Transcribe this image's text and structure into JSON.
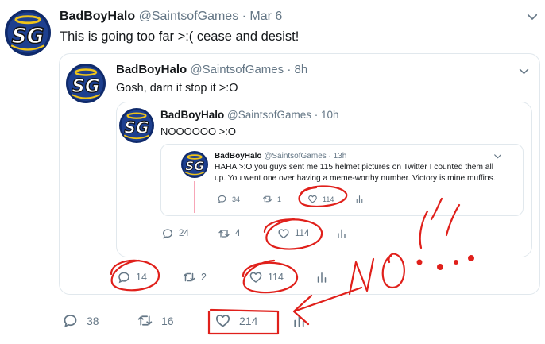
{
  "tweet": {
    "name": "BadBoyHalo",
    "handle": "@SaintsofGames",
    "time": "· Mar 6",
    "text": "This is going too far >:( cease and desist!",
    "replies": "38",
    "retweets": "16",
    "likes": "214"
  },
  "quote1": {
    "name": "BadBoyHalo",
    "handle": "@SaintsofGames",
    "time": "· 8h",
    "text": "Gosh, darn it stop it >:O",
    "replies": "14",
    "retweets": "2",
    "likes": "114"
  },
  "quote2": {
    "name": "BadBoyHalo",
    "handle": "@SaintsofGames",
    "time": "· 10h",
    "text": "NOOOOOO >:O",
    "replies": "24",
    "retweets": "4",
    "likes": "114"
  },
  "quote3": {
    "name": "BadBoyHalo",
    "handle": "@SaintsofGames",
    "time": "· 13h",
    "text_line1": "HAHA >:O you guys sent me 115 helmet pictures on Twitter I counted them all",
    "text_line2": "up. You went one over having a meme-worthy number. Victory is mine muffins.",
    "replies": "34",
    "retweets": "1",
    "likes": "114"
  },
  "annotation": {
    "text": "NO!!!",
    "color": "#e0201b"
  },
  "icons": [
    "avatar-logo",
    "chevron-down-icon",
    "reply-icon",
    "retweet-icon",
    "like-icon",
    "analytics-icon"
  ]
}
